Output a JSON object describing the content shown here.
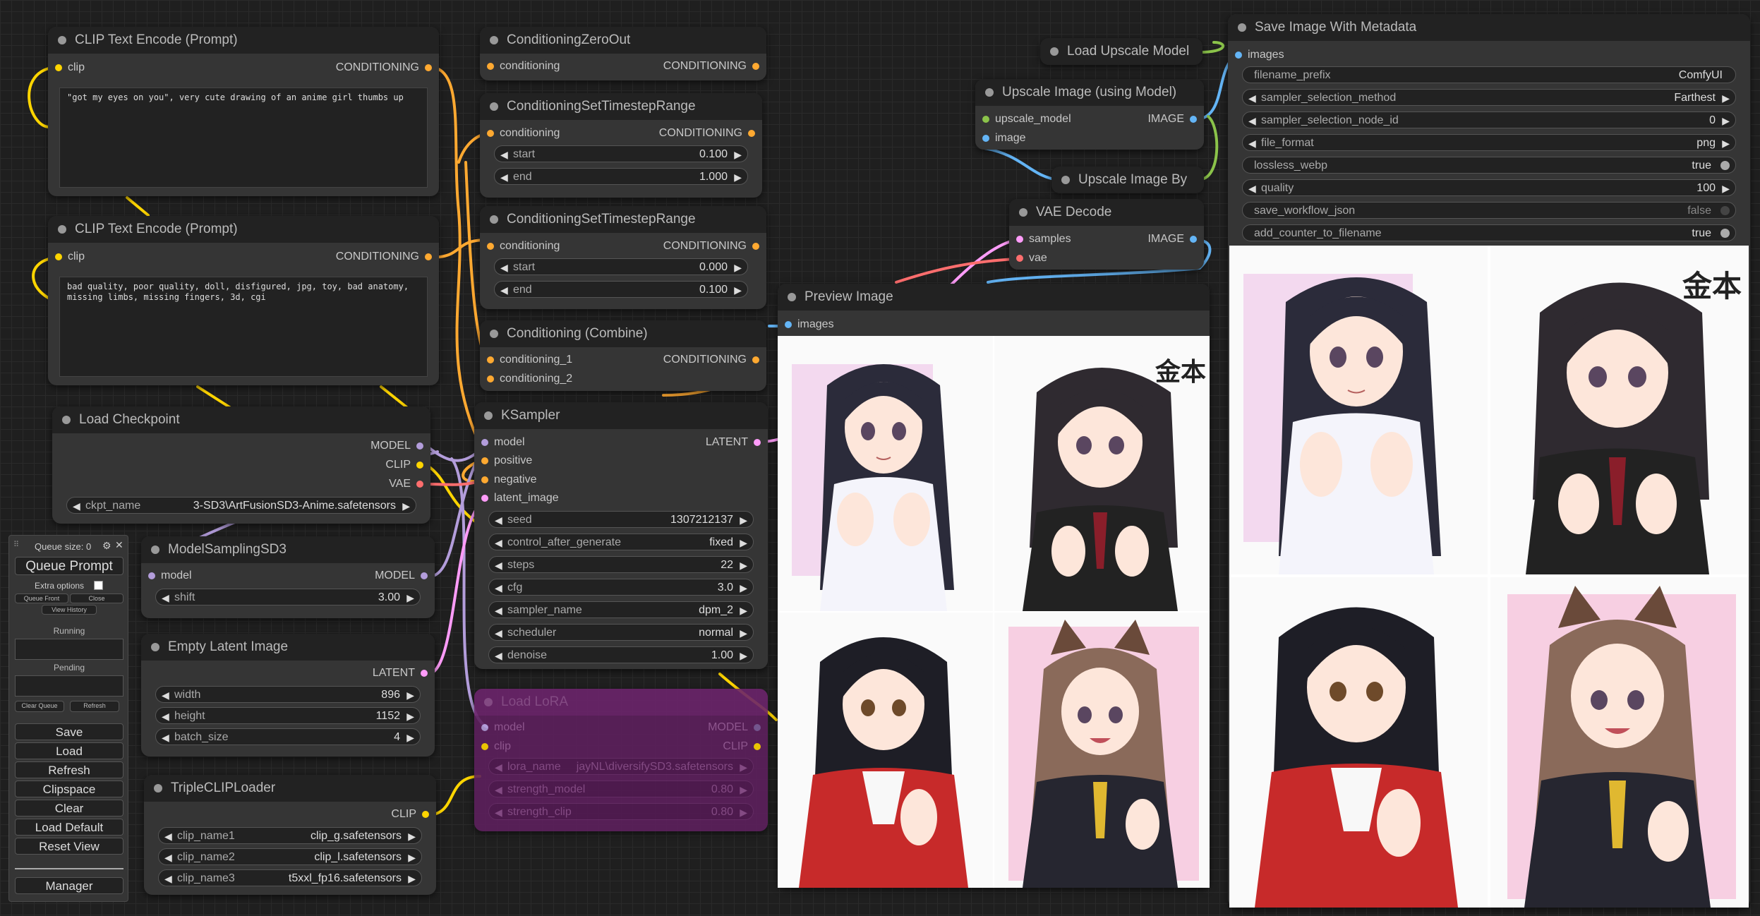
{
  "colors": {
    "clip": "#FFD500",
    "conditioning": "#FFA931",
    "model": "#B39DDB",
    "vae": "#FF6E6E",
    "latent": "#FF9CF9",
    "image": "#64B5F6",
    "upscale": "#8BC34A"
  },
  "nodes": {
    "clip1": {
      "title": "CLIP Text Encode (Prompt)",
      "in_clip": "clip",
      "out": "CONDITIONING",
      "text": "\"got my eyes on you\", very cute drawing of an anime girl thumbs up"
    },
    "clip2": {
      "title": "CLIP Text Encode (Prompt)",
      "in_clip": "clip",
      "out": "CONDITIONING",
      "text": "bad quality, poor quality, doll, disfigured, jpg, toy, bad anatomy,\nmissing limbs, missing fingers, 3d, cgi"
    },
    "checkpoint": {
      "title": "Load Checkpoint",
      "out_model": "MODEL",
      "out_clip": "CLIP",
      "out_vae": "VAE",
      "ckpt_label": "ckpt_name",
      "ckpt_value": "3-SD3\\ArtFusionSD3-Anime.safetensors"
    },
    "msd3": {
      "title": "ModelSamplingSD3",
      "in_model": "model",
      "out_model": "MODEL",
      "shift_label": "shift",
      "shift_value": "3.00"
    },
    "latent": {
      "title": "Empty Latent Image",
      "out": "LATENT",
      "width_label": "width",
      "width_value": "896",
      "height_label": "height",
      "height_value": "1152",
      "batch_label": "batch_size",
      "batch_value": "4"
    },
    "triple": {
      "title": "TripleCLIPLoader",
      "out": "CLIP",
      "c1_label": "clip_name1",
      "c1_value": "clip_g.safetensors",
      "c2_label": "clip_name2",
      "c2_value": "clip_l.safetensors",
      "c3_label": "clip_name3",
      "c3_value": "t5xxl_fp16.safetensors"
    },
    "czero": {
      "title": "ConditioningZeroOut",
      "in": "conditioning",
      "out": "CONDITIONING"
    },
    "cstr1": {
      "title": "ConditioningSetTimestepRange",
      "in": "conditioning",
      "out": "CONDITIONING",
      "start_label": "start",
      "start_value": "0.100",
      "end_label": "end",
      "end_value": "1.000"
    },
    "cstr2": {
      "title": "ConditioningSetTimestepRange",
      "in": "conditioning",
      "out": "CONDITIONING",
      "start_label": "start",
      "start_value": "0.000",
      "end_label": "end",
      "end_value": "0.100"
    },
    "ccomb": {
      "title": "Conditioning (Combine)",
      "in1": "conditioning_1",
      "in2": "conditioning_2",
      "out": "CONDITIONING"
    },
    "ksampler": {
      "title": "KSampler",
      "in_model": "model",
      "in_pos": "positive",
      "in_neg": "negative",
      "in_latent": "latent_image",
      "out": "LATENT",
      "widgets": [
        {
          "label": "seed",
          "value": "1307212137"
        },
        {
          "label": "control_after_generate",
          "value": "fixed"
        },
        {
          "label": "steps",
          "value": "22"
        },
        {
          "label": "cfg",
          "value": "3.0"
        },
        {
          "label": "sampler_name",
          "value": "dpm_2"
        },
        {
          "label": "scheduler",
          "value": "normal"
        },
        {
          "label": "denoise",
          "value": "1.00"
        }
      ]
    },
    "lora": {
      "title": "Load LoRA",
      "in_model": "model",
      "in_clip": "clip",
      "out_model": "MODEL",
      "out_clip": "CLIP",
      "widgets": [
        {
          "label": "lora_name",
          "value": "jayNL\\diversifySD3.safetensors"
        },
        {
          "label": "strength_model",
          "value": "0.80"
        },
        {
          "label": "strength_clip",
          "value": "0.80"
        }
      ]
    },
    "upmodel": {
      "title": "Load Upscale Model"
    },
    "upimage": {
      "title": "Upscale Image (using Model)",
      "in1": "upscale_model",
      "in2": "image",
      "out": "IMAGE"
    },
    "upby": {
      "title": "Upscale Image By"
    },
    "vaedec": {
      "title": "VAE Decode",
      "in1": "samples",
      "in2": "vae",
      "out": "IMAGE"
    },
    "preview": {
      "title": "Preview Image",
      "in": "images"
    },
    "save": {
      "title": "Save Image With Metadata",
      "in": "images",
      "widgets": [
        {
          "label": "filename_prefix",
          "value": "ComfyUI",
          "kind": "text"
        },
        {
          "label": "sampler_selection_method",
          "value": "Farthest",
          "kind": "combo"
        },
        {
          "label": "sampler_selection_node_id",
          "value": "0",
          "kind": "combo"
        },
        {
          "label": "file_format",
          "value": "png",
          "kind": "combo"
        },
        {
          "label": "lossless_webp",
          "value": "true",
          "kind": "toggle"
        },
        {
          "label": "quality",
          "value": "100",
          "kind": "combo"
        },
        {
          "label": "save_workflow_json",
          "value": "false",
          "kind": "toggle"
        },
        {
          "label": "add_counter_to_filename",
          "value": "true",
          "kind": "toggle"
        }
      ]
    }
  },
  "sticker_text": "金本",
  "queue_panel": {
    "queue_size": "Queue size: 0",
    "queue_prompt": "Queue Prompt",
    "extra_options": "Extra options",
    "queue_front": "Queue Front",
    "close": "Close",
    "view_history": "View History",
    "running": "Running",
    "pending": "Pending",
    "clear_queue": "Clear Queue",
    "refresh_small": "Refresh",
    "buttons": [
      "Save",
      "Load",
      "Refresh",
      "Clipspace",
      "Clear",
      "Load Default",
      "Reset View"
    ],
    "manager": "Manager"
  }
}
